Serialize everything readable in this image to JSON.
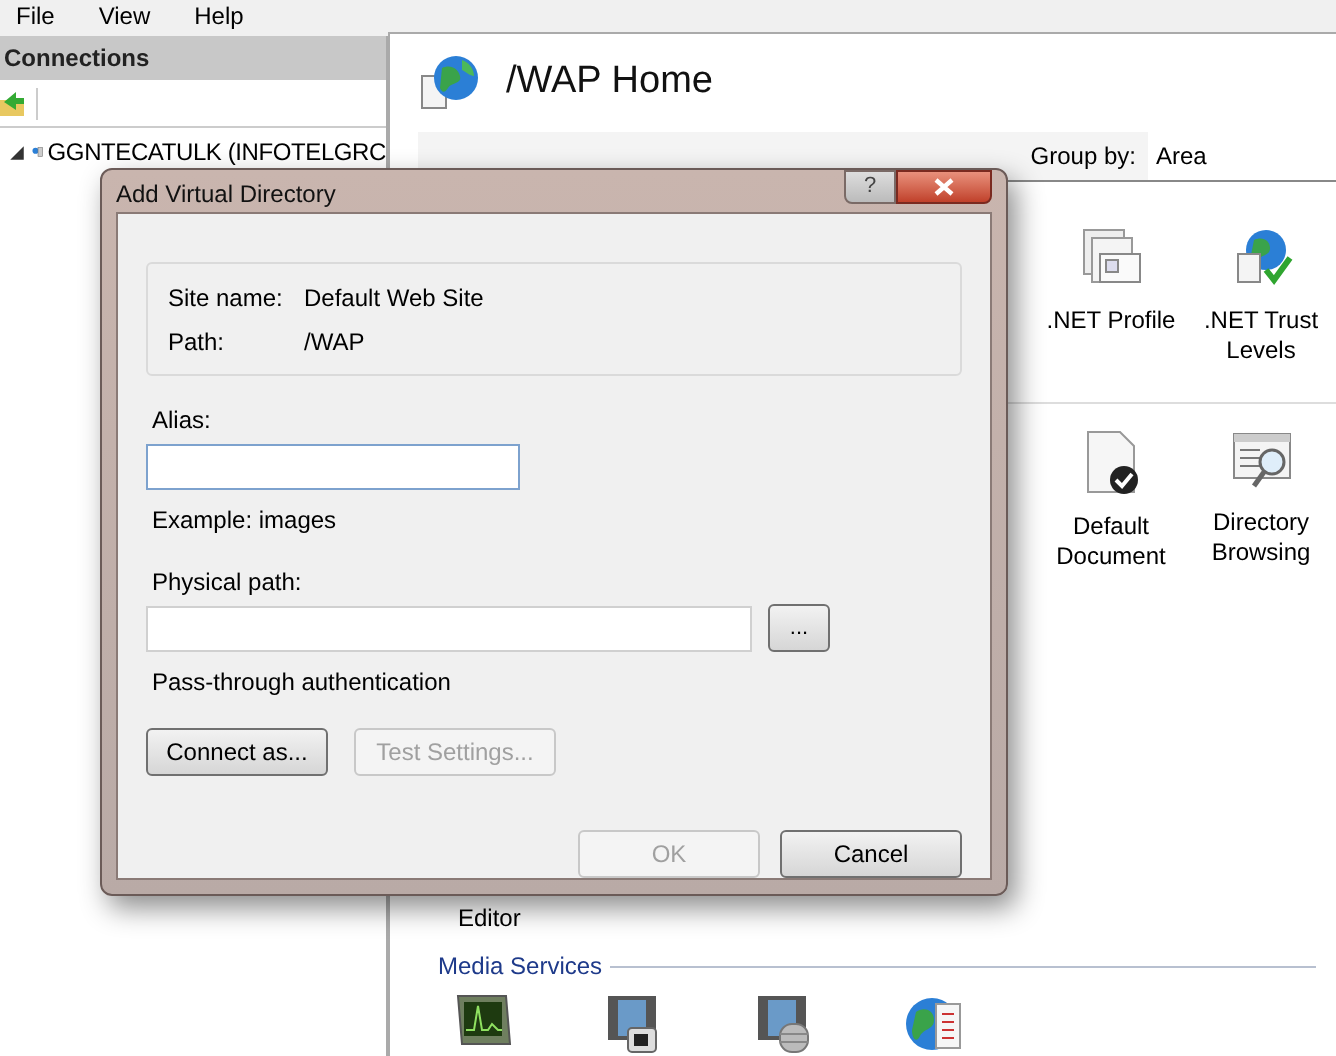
{
  "menu": [
    "File",
    "View",
    "Help"
  ],
  "connections": {
    "title": "Connections",
    "tree": [
      {
        "label": "GGNTECATULK (INFOTELGRC",
        "expanded": true
      }
    ]
  },
  "home": {
    "title": "/WAP Home",
    "group_by": {
      "label": "Group by:",
      "value": "Area"
    },
    "feature_rows": [
      {
        "items": [
          {
            "label": ".NET Profile",
            "kind": "profile"
          },
          {
            "label": ".NET Trust Levels",
            "kind": "trust"
          }
        ]
      },
      {
        "items": [
          {
            "label": "Default Document",
            "kind": "document"
          },
          {
            "label": "Directory Browsing",
            "kind": "browse"
          }
        ]
      }
    ],
    "editor_label": "Editor",
    "sections": [
      {
        "title": "Media Services",
        "items": [
          {
            "kind": "monitor"
          },
          {
            "kind": "film-camera"
          },
          {
            "kind": "film-db"
          },
          {
            "kind": "globe-doc"
          }
        ]
      }
    ]
  },
  "dialog": {
    "title": "Add Virtual Directory",
    "help": "?",
    "site_name_label": "Site name:",
    "site_name": "Default Web Site",
    "path_label": "Path:",
    "path": "/WAP",
    "alias_label": "Alias:",
    "alias_focused": true,
    "example": "Example: images",
    "physical_path_label": "Physical path:",
    "browse": "...",
    "pass_through": "Pass-through authentication",
    "buttons": [
      {
        "label": "Connect as...",
        "disabled": false
      },
      {
        "label": "Test Settings...",
        "disabled": true
      }
    ],
    "footer_buttons": [
      {
        "label": "OK",
        "disabled": true
      },
      {
        "label": "Cancel",
        "disabled": false
      }
    ]
  }
}
